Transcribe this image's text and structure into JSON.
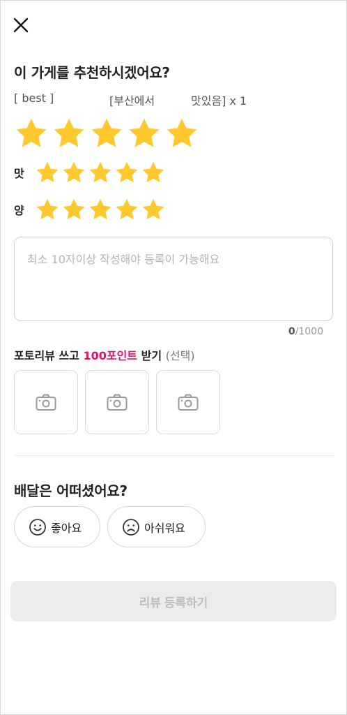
{
  "header": {
    "close_icon": "close-icon"
  },
  "title": "이 가게를 추천하시겠어요?",
  "menu": {
    "col1": "[ best ]",
    "col2": "[부산에서",
    "col3": "맛있음] x 1"
  },
  "rating": {
    "overall": 5,
    "max": 5,
    "star_color": "#FFC82C",
    "taste_label": "맛",
    "taste": 5,
    "amount_label": "양",
    "amount": 5
  },
  "review": {
    "placeholder": "최소 10자이상 작성해야 등록이 가능해요",
    "value": "",
    "count_current": "0",
    "count_max": "/1000"
  },
  "photo_review": {
    "title_prefix": "포토리뷰 쓰고 ",
    "title_highlight": "100포인트",
    "title_suffix": " 받기",
    "optional": "(선택)",
    "highlight_color": "#D6186B",
    "slots": [
      "camera-icon",
      "camera-icon",
      "camera-icon"
    ]
  },
  "delivery": {
    "title": "배달은 어떠셨어요?",
    "good_label": "좋아요",
    "bad_label": "아쉬워요"
  },
  "submit": {
    "label": "리뷰 등록하기"
  }
}
